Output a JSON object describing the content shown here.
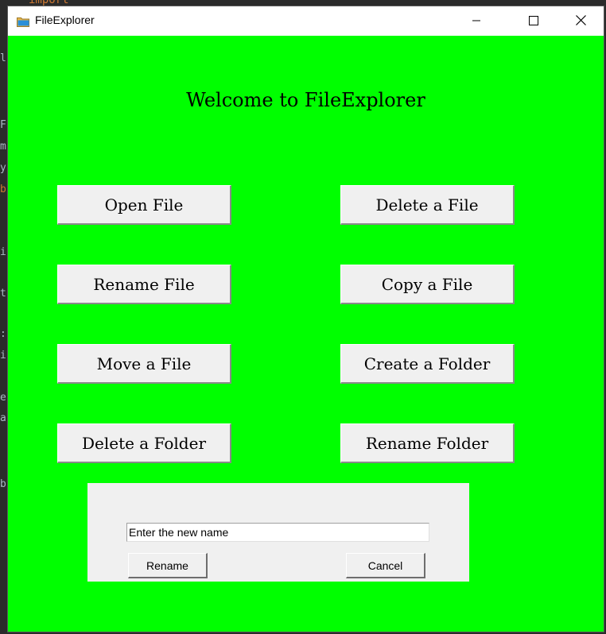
{
  "window": {
    "title": "FileExplorer",
    "background_color": "#00ff00",
    "icon": "folder-icon"
  },
  "background_editor": {
    "top_fragment": "import *",
    "line_chars": [
      "l",
      "F",
      "m",
      "y",
      "b",
      "i",
      "t",
      ":",
      "i",
      "e",
      "a",
      "b"
    ]
  },
  "main": {
    "heading": "Welcome to FileExplorer",
    "buttons": {
      "open_file": "Open File",
      "delete_file": "Delete a File",
      "rename_file": "Rename File",
      "copy_file": "Copy a File",
      "move_file": "Move a File",
      "create_folder": "Create a Folder",
      "delete_folder": "Delete a Folder",
      "rename_folder": "Rename Folder"
    }
  },
  "rename_panel": {
    "entry_value": "Enter the new name",
    "rename_label": "Rename",
    "cancel_label": "Cancel"
  }
}
